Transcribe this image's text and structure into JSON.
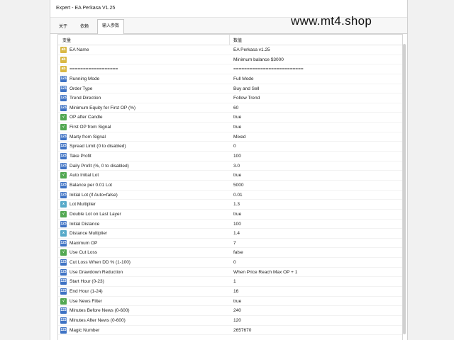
{
  "window": {
    "title": "Expert - EA Perkasa V1.25",
    "tabs": [
      "关于",
      "依赖",
      "输入参数"
    ],
    "active_tab": 2,
    "watermark": "www.mt4.shop"
  },
  "table": {
    "headers": [
      "变量",
      "数值"
    ],
    "rows": [
      {
        "icon": "ab",
        "name": "EA Name",
        "value": "EA Perkasa v1.25"
      },
      {
        "icon": "ab",
        "name": "",
        "value": "Minimum balance $3000"
      },
      {
        "icon": "ab",
        "name": "==================",
        "value": "=========================="
      },
      {
        "icon": "num",
        "name": "Running Mode",
        "value": "Full Mode"
      },
      {
        "icon": "num",
        "name": "Order Type",
        "value": "Buy and Sell"
      },
      {
        "icon": "num",
        "name": "Trend Direction",
        "value": "Follow Trend"
      },
      {
        "icon": "num",
        "name": "Minimum Equity for First OP (%)",
        "value": "60"
      },
      {
        "icon": "bool",
        "name": "OP after Candle",
        "value": "true"
      },
      {
        "icon": "bool",
        "name": "First OP from Signal",
        "value": "true"
      },
      {
        "icon": "num",
        "name": "Marty from Signal",
        "value": "Mixed"
      },
      {
        "icon": "num",
        "name": "Spread Limit (0 to disabled)",
        "value": "0"
      },
      {
        "icon": "num",
        "name": "Take Profit",
        "value": "100"
      },
      {
        "icon": "num",
        "name": "Daily Profit (%, 0 to disabled)",
        "value": "3.0"
      },
      {
        "icon": "bool",
        "name": "Auto Initial Lot",
        "value": "true"
      },
      {
        "icon": "num",
        "name": "Balance per 0.01 Lot",
        "value": "5000"
      },
      {
        "icon": "num",
        "name": "Initial Lot (if Auto=false)",
        "value": "0.01"
      },
      {
        "icon": "multi",
        "name": "Lot Multiplier",
        "value": "1.3"
      },
      {
        "icon": "bool",
        "name": "Double Lot on Last Layer",
        "value": "true"
      },
      {
        "icon": "num",
        "name": "Initial Distance",
        "value": "100"
      },
      {
        "icon": "multi",
        "name": "Distance Multiplier",
        "value": "1.4"
      },
      {
        "icon": "num",
        "name": "Maximum OP",
        "value": "7"
      },
      {
        "icon": "bool",
        "name": "Use Cut Loss",
        "value": "false"
      },
      {
        "icon": "num",
        "name": "Cut Loss When DD % (1-100)",
        "value": "0"
      },
      {
        "icon": "num",
        "name": "Use Drawdown Reduction",
        "value": "When Price Reach Max OP + 1"
      },
      {
        "icon": "num",
        "name": "Start Hour (0-23)",
        "value": "1"
      },
      {
        "icon": "num",
        "name": "End Hour (1-24)",
        "value": "16"
      },
      {
        "icon": "bool",
        "name": "Use News Filter",
        "value": "true"
      },
      {
        "icon": "num",
        "name": "Minutes Before News (0-600)",
        "value": "240"
      },
      {
        "icon": "num",
        "name": "Minutes After News (0-600)",
        "value": "120"
      },
      {
        "icon": "num",
        "name": "Magic Number",
        "value": "2657670"
      }
    ]
  }
}
